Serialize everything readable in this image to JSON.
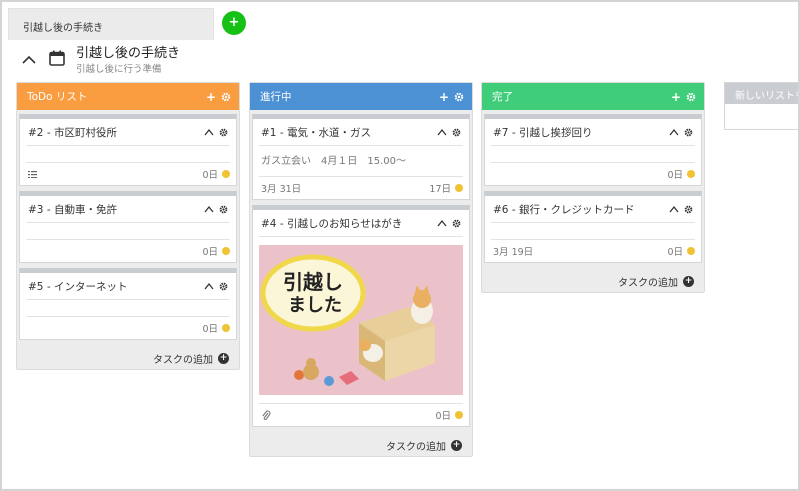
{
  "tabs": [
    {
      "label": "引越し後の手続き"
    }
  ],
  "tab_add_label": "+",
  "board": {
    "title": "引越し後の手続き",
    "subtitle": "引越し後に行う準備"
  },
  "columns": [
    {
      "title": "ToDo リスト",
      "color": "#f99d40",
      "add_task_label": "タスクの追加",
      "cards": [
        {
          "title": "#2 - 市区町村役所",
          "days": "0日",
          "date": "",
          "note": "",
          "has_list_icon": true
        },
        {
          "title": "#3 - 自動車・免許",
          "days": "0日",
          "date": "",
          "note": ""
        },
        {
          "title": "#5 - インターネット",
          "days": "0日",
          "date": "",
          "note": ""
        }
      ]
    },
    {
      "title": "進行中",
      "color": "#4d91d5",
      "add_task_label": "タスクの追加",
      "cards": [
        {
          "title": "#1 - 電気・水道・ガス",
          "note": "ガス立会い　4月１日　15.00〜",
          "date": "3月 31日",
          "days": "17日"
        },
        {
          "title": "#4 - 引越しのお知らせはがき",
          "days": "0日",
          "date": "",
          "has_attachment": true,
          "image_text": "引越しました"
        }
      ]
    },
    {
      "title": "完了",
      "color": "#3fcd7a",
      "add_task_label": "タスクの追加",
      "cards": [
        {
          "title": "#7 - 引越し挨拶回り",
          "days": "0日",
          "date": "",
          "note": ""
        },
        {
          "title": "#6 - 銀行・クレジットカード",
          "days": "0日",
          "date": "3月 19日",
          "note": ""
        }
      ]
    }
  ],
  "new_list": {
    "title": "新しいリストを"
  },
  "colors": {
    "dot": "#f1c232",
    "tab_add": "#16c116"
  }
}
